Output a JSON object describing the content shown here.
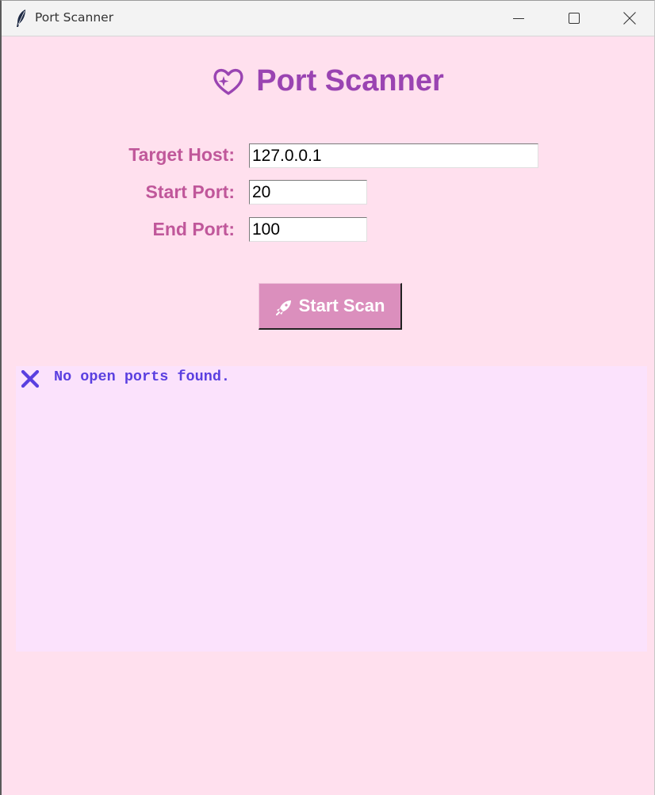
{
  "window": {
    "title": "Port Scanner",
    "app_icon": "feather-icon",
    "controls": {
      "minimize_icon": "minimize-icon",
      "maximize_icon": "maximize-icon",
      "close_icon": "close-icon"
    }
  },
  "header": {
    "icon": "heart-sparkle-icon",
    "title": "Port Scanner"
  },
  "form": {
    "target_host": {
      "label": "Target Host:",
      "value": "127.0.0.1"
    },
    "start_port": {
      "label": "Start Port:",
      "value": "20"
    },
    "end_port": {
      "label": "End Port:",
      "value": "100"
    }
  },
  "scan_button": {
    "icon": "rocket-icon",
    "label": "Start Scan"
  },
  "output": {
    "icon": "cross-mark-icon",
    "message": "No open ports found."
  },
  "colors": {
    "background": "#ffe0ee",
    "title": "#9a44b2",
    "label": "#c0579a",
    "button": "#db8fbd",
    "output_background": "#fbe2fc",
    "output_text": "#5a3fe0"
  }
}
